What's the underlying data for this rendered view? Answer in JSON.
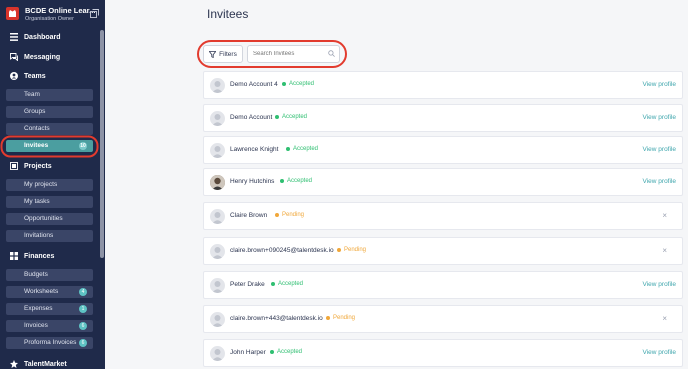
{
  "org": {
    "name": "BCDE Online Lear...",
    "role": "Organisation Owner"
  },
  "nav": {
    "dashboard": "Dashboard",
    "messaging": "Messaging",
    "teams": "Teams",
    "team_items": [
      {
        "label": "Team"
      },
      {
        "label": "Groups"
      },
      {
        "label": "Contacts"
      },
      {
        "label": "Invitees",
        "count": "10",
        "active": true
      }
    ],
    "projects": "Projects",
    "project_items": [
      {
        "label": "My projects"
      },
      {
        "label": "My tasks"
      },
      {
        "label": "Opportunities"
      },
      {
        "label": "Invitations"
      }
    ],
    "finances": "Finances",
    "finance_items": [
      {
        "label": "Budgets"
      },
      {
        "label": "Worksheets",
        "count": "4"
      },
      {
        "label": "Expenses",
        "count": "1"
      },
      {
        "label": "Invoices",
        "count": "6"
      },
      {
        "label": "Proforma Invoices",
        "count": "6"
      }
    ],
    "talentmarket": "TalentMarket"
  },
  "page": {
    "title": "Invitees",
    "filters_label": "Filters",
    "search_placeholder": "Search Invitees"
  },
  "colors": {
    "accepted": "#2fbf71",
    "pending": "#f0a73a",
    "link": "#3fa6ad",
    "highlight": "#e23b2e"
  },
  "invitees": [
    {
      "name": "Demo Account 4",
      "status": "Accepted",
      "action": "View profile"
    },
    {
      "name": "Demo Account",
      "status": "Accepted",
      "action": "View profile"
    },
    {
      "name": "Lawrence Knight",
      "status": "Accepted",
      "action": "View profile"
    },
    {
      "name": "Henry Hutchins",
      "status": "Accepted",
      "action": "View profile"
    },
    {
      "name": "Claire Brown",
      "status": "Pending",
      "action": "×"
    },
    {
      "name": "claire.brown+090245@talentdesk.io",
      "status": "Pending",
      "action": "×"
    },
    {
      "name": "Peter Drake",
      "status": "Accepted",
      "action": "View profile"
    },
    {
      "name": "claire.brown+443@talentdesk.io",
      "status": "Pending",
      "action": "×"
    },
    {
      "name": "John Harper",
      "status": "Accepted",
      "action": "View profile"
    }
  ]
}
